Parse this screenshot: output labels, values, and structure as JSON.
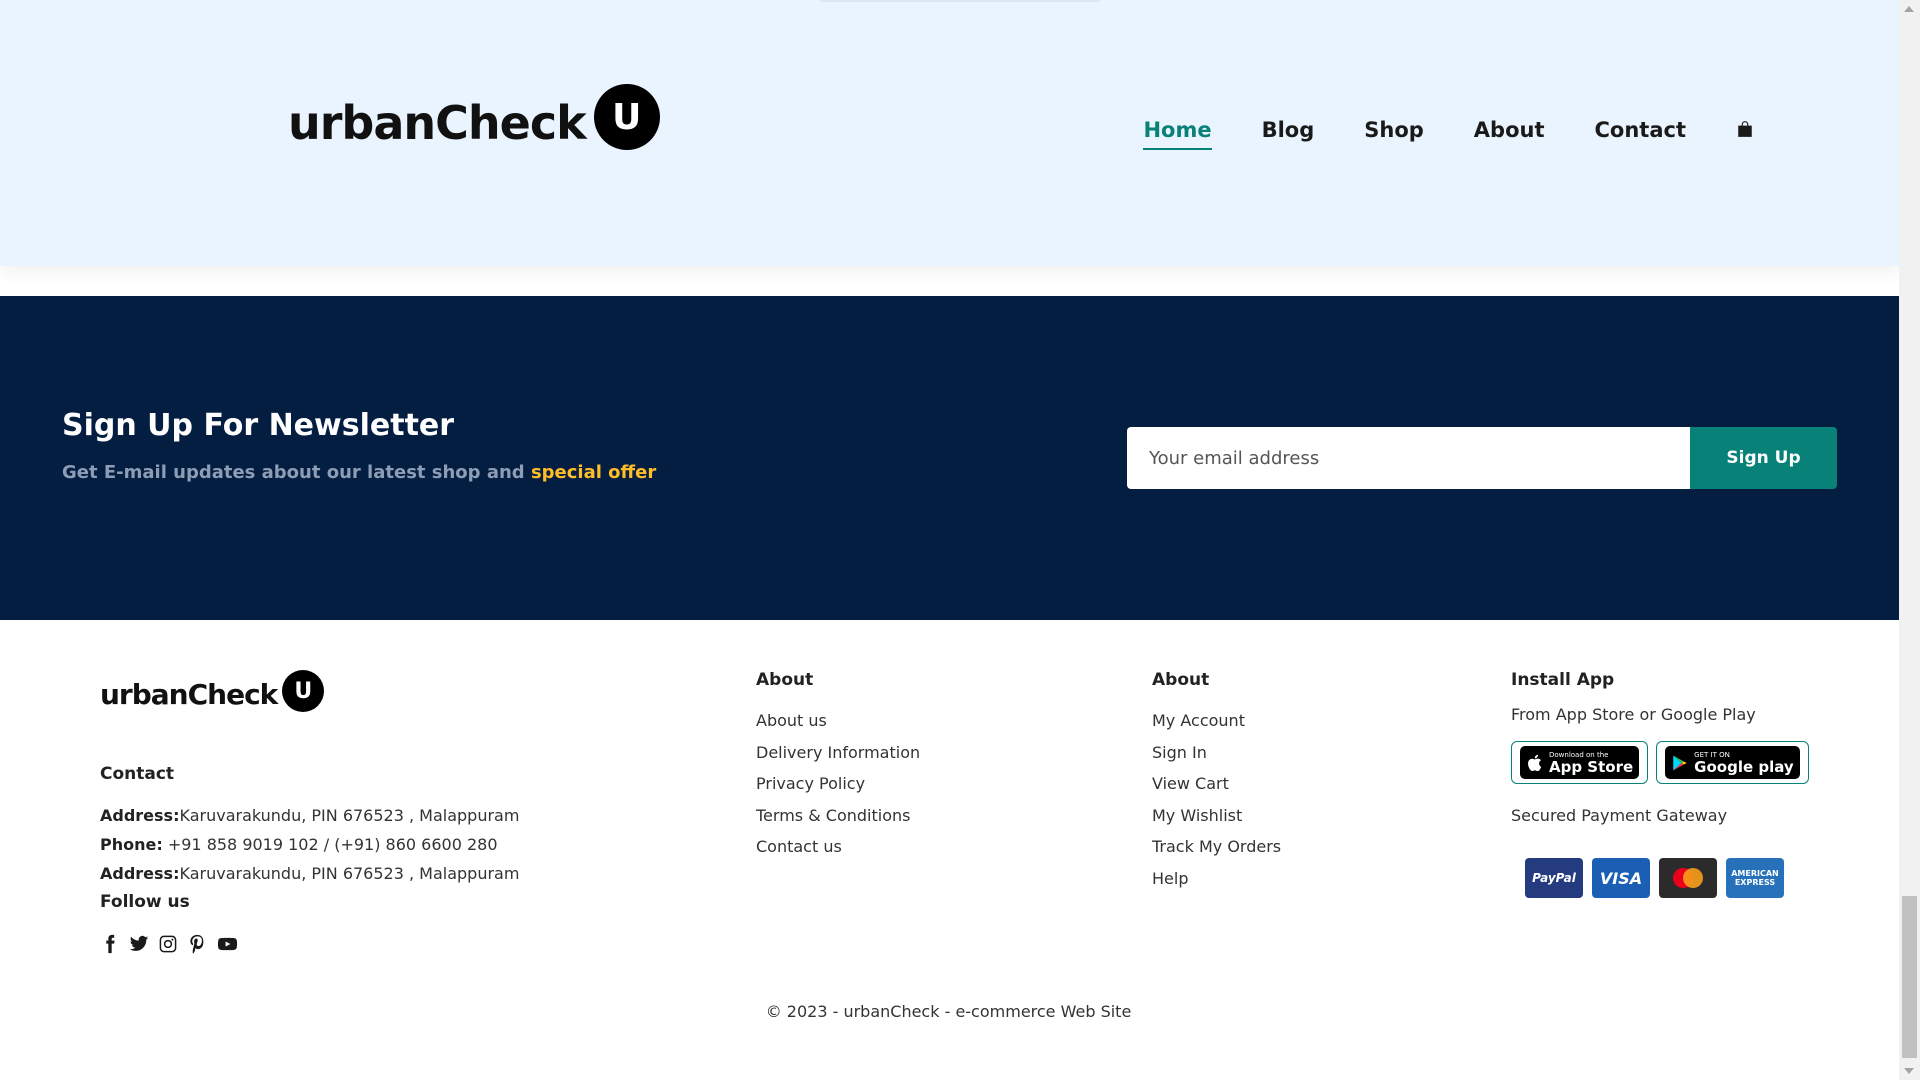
{
  "header": {
    "logo_text": "urbanCheck",
    "logo_badge": "U",
    "nav": [
      {
        "label": "Home",
        "active": true
      },
      {
        "label": "Blog",
        "active": false
      },
      {
        "label": "Shop",
        "active": false
      },
      {
        "label": "About",
        "active": false
      },
      {
        "label": "Contact",
        "active": false
      }
    ],
    "cart_icon": "shopping-bag-icon"
  },
  "newsletter": {
    "title": "Sign Up For Newsletter",
    "subtitle_prefix": "Get E-mail updates about our latest shop and ",
    "subtitle_highlight": "special offer",
    "email_placeholder": "Your email address",
    "button_label": "Sign Up"
  },
  "footer": {
    "logo_text": "urbanCheck",
    "logo_badge": "U",
    "contact_heading": "Contact",
    "address_label": "Address:",
    "address_value": "Karuvarakundu, PIN 676523 , Malappuram",
    "phone_label": "Phone:",
    "phone_value": " +91 858 9019 102 / (+91) 860 6600 280",
    "address2_label": "Address:",
    "address2_value": "Karuvarakundu, PIN 676523 , Malappuram",
    "follow_heading": "Follow us",
    "social_icons": [
      "facebook-icon",
      "twitter-icon",
      "instagram-icon",
      "pinterest-icon",
      "youtube-icon"
    ],
    "about_col": {
      "heading": "About",
      "links": [
        "About us",
        "Delivery Information",
        "Privacy Policy",
        "Terms & Conditions",
        "Contact us"
      ]
    },
    "account_col": {
      "heading": "About",
      "links": [
        "My Account",
        "Sign In",
        "View Cart",
        "My Wishlist",
        "Track My Orders",
        "Help"
      ]
    },
    "install_col": {
      "heading": "Install App",
      "subtitle": "From App Store or Google Play",
      "app_store_small": "Download on the",
      "app_store_big": "App Store",
      "google_play_small": "GET IT ON",
      "google_play_big": "Google play",
      "secure_text": "Secured Payment Gateway",
      "payments": [
        "PayPal",
        "VISA",
        "",
        "AMERICAN EXPRESS"
      ]
    },
    "copyright": "© 2023 - urbanCheck - e-commerce Web Site"
  },
  "colors": {
    "accent": "#088178",
    "header_bg": "#eaf4fe",
    "newsletter_bg": "#041e42",
    "highlight": "#ffbd27"
  }
}
